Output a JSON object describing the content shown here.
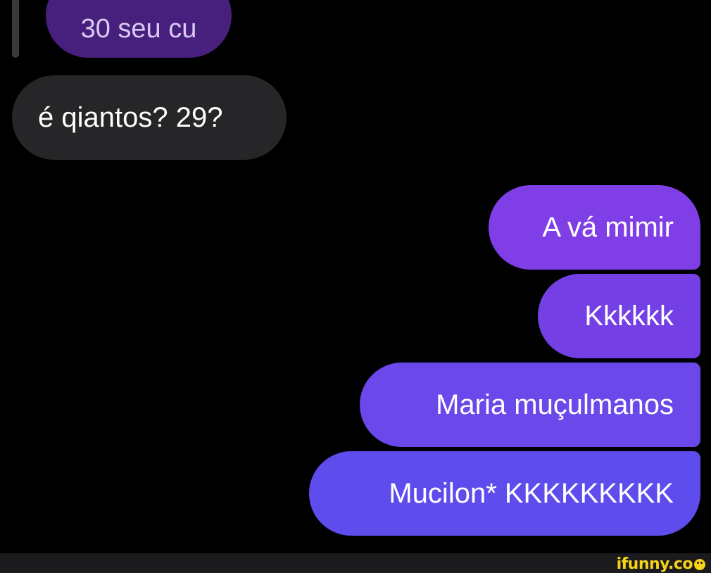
{
  "conversation": {
    "quoted_reply": "30 seu cu",
    "received": [
      {
        "text": "é qiantos? 29?"
      }
    ],
    "sent": [
      {
        "text": "A vá mimir"
      },
      {
        "text": "Kkkkkk"
      },
      {
        "text": "Maria muçulmanos"
      },
      {
        "text": "Mucilon* KKKKKKKKK"
      }
    ]
  },
  "watermark": {
    "text": "ifunny.co",
    "color": "#f6d21a",
    "icon": "smiley-icon"
  },
  "colors": {
    "background": "#000000",
    "received_bubble": "#262628",
    "quoted_bubble": "#47207e",
    "sent_gradient_top": "#7f3ee6",
    "sent_gradient_bottom": "#5e4ced"
  }
}
